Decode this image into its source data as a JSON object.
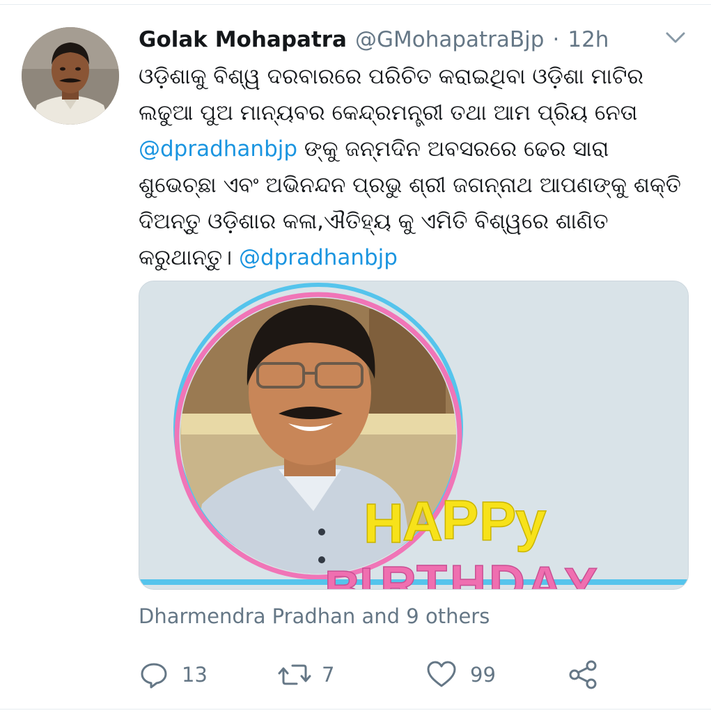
{
  "tweet": {
    "author": {
      "name": "Golak Mohapatra",
      "handle": "@GMohapatraBjp",
      "separator": "·",
      "time": "12h"
    },
    "text_lines": [
      [
        {
          "t": "ଓଡ଼ିଶାକୁ ବିଶ୍ୱ ଦରବାରରେ ପରିଚିତ କରାଇଥିବା ଓଡ଼ିଶା ମାଟିର",
          "m": false
        }
      ],
      [
        {
          "t": "ଲଢୁଆ ପୁଅ ମାନ୍ୟବର କେନ୍ଦ୍ରମନ୍ତ୍ରୀ ତଥା ଆମ ପ୍ରିୟ ନେତା",
          "m": false
        }
      ],
      [
        {
          "t": "@dpradhanbjp",
          "m": true
        },
        {
          "t": " ଙ୍କୁ ଜନ୍ମଦିନ ଅବସରରେ ଢେର ସାରା",
          "m": false
        }
      ],
      [
        {
          "t": "ଶୁଭେଚ୍ଛା ଏବଂ ଅଭିନନ୍ଦନ ପ୍ରଭୁ ଶ୍ରୀ ଜଗନ୍ନାଥ ଆପଣଙ୍କୁ ଶକ୍ତି",
          "m": false
        }
      ],
      [
        {
          "t": "ଦିଅନ୍ତୁ ଓଡ଼ିଶାର କଳା,ଐତିହ୍ୟ କୁ ଏମିତି ବିଶ୍ୱରେ ଶାଣିତ",
          "m": false
        }
      ],
      [
        {
          "t": "କରୁଥାନ୍ତୁ। ",
          "m": false
        },
        {
          "t": "@dpradhanbjp",
          "m": true
        }
      ]
    ],
    "media": {
      "happy": [
        "H",
        "A",
        "P",
        "P",
        "y"
      ],
      "birthday": [
        "B",
        "I",
        "R",
        "T",
        "H",
        "D",
        "A",
        "Y"
      ]
    },
    "liked_by": "Dharmendra Pradhan and 9 others",
    "actions": {
      "reply_count": "13",
      "retweet_count": "7",
      "like_count": "99"
    },
    "icons": {
      "caret": "chevron-down-icon",
      "reply": "reply-icon",
      "retweet": "retweet-icon",
      "like": "heart-icon",
      "share": "share-icon"
    },
    "colors": {
      "link": "#1b95e0",
      "secondary_text": "#657786",
      "happy_text": "#f7e21a",
      "birthday_text": "#ef6fb0",
      "frame_pink": "#f075b7",
      "frame_blue": "#55c4ec",
      "media_bg": "#d9e3e8"
    }
  }
}
